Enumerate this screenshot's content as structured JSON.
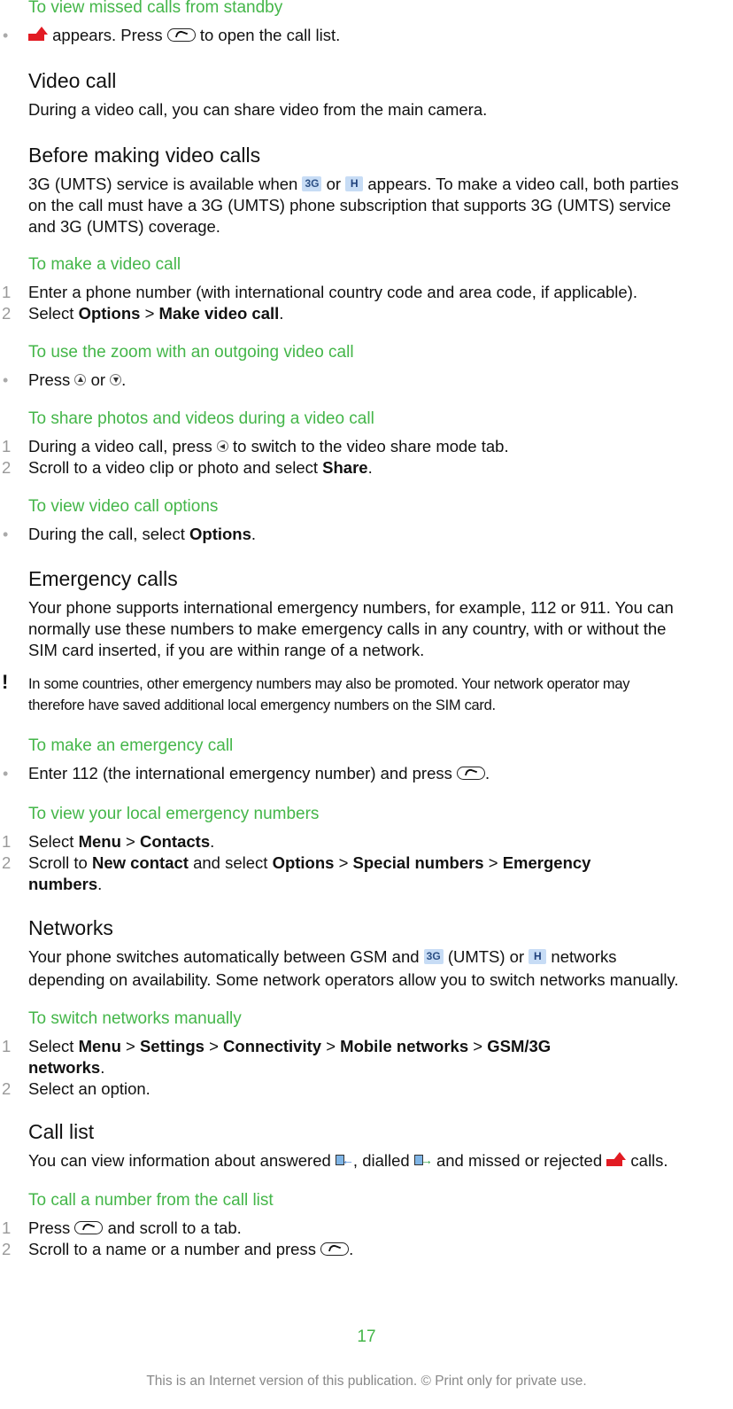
{
  "sections": {
    "missed_standby": {
      "heading": "To view missed calls from standby",
      "bullet": {
        "icon": "missed-call-icon",
        "t1": "appears. Press",
        "icon2": "call-key-icon",
        "t2": "to open the call list."
      }
    },
    "video_call": {
      "heading": "Video call",
      "body": "During a video call, you can share video from the main camera."
    },
    "before_video": {
      "heading": "Before making video calls",
      "t1": "3G (UMTS) service is available when",
      "icon_3g": "3G",
      "t_or": "or",
      "icon_h": "H",
      "line1_end": "appears. To make a video call, both parties",
      "line2": "on the call must have a 3G (UMTS) phone subscription that supports 3G (UMTS) service",
      "line3": "and 3G (UMTS) coverage."
    },
    "make_video": {
      "heading": "To make a video call",
      "steps": [
        {
          "num": "1",
          "text": "Enter a phone number (with international country code and area code, if applicable)."
        },
        {
          "num": "2",
          "pre": "Select ",
          "b1": "Options",
          "sep": " > ",
          "b2": "Make video call",
          "post": "."
        }
      ]
    },
    "zoom": {
      "heading": "To use the zoom with an outgoing video call",
      "bullet": {
        "t1": "Press",
        "t_or": "or",
        "post": "."
      }
    },
    "share": {
      "heading": "To share photos and videos during a video call",
      "steps": [
        {
          "num": "1",
          "t1": "During a video call, press",
          "t2": "to switch to the video share mode tab."
        },
        {
          "num": "2",
          "pre": "Scroll to a video clip or photo and select ",
          "b1": "Share",
          "post": "."
        }
      ]
    },
    "view_options": {
      "heading": "To view video call options",
      "bullet": {
        "pre": "During the call, select ",
        "b1": "Options",
        "post": "."
      }
    },
    "emergency": {
      "heading": "Emergency calls",
      "line1": "Your phone supports international emergency numbers, for example, 112 or 911. You can",
      "line2": "normally use these numbers to make emergency calls in any country, with or without the",
      "line3": "SIM card inserted, if you are within range of a network.",
      "note_mark": "!",
      "note1": "In some countries, other emergency numbers may also be promoted. Your network operator may",
      "note2": "therefore have saved additional local emergency numbers on the SIM card."
    },
    "make_emergency": {
      "heading": "To make an emergency call",
      "bullet": {
        "t1": "Enter 112 (the international emergency number) and press",
        "post": "."
      }
    },
    "local_emergency": {
      "heading": "To view your local emergency numbers",
      "steps": [
        {
          "num": "1",
          "pre": "Select ",
          "b1": "Menu",
          "sep": " > ",
          "b2": "Contacts",
          "post": "."
        },
        {
          "num": "2",
          "pre": "Scroll to ",
          "b1": "New contact",
          "mid": " and select ",
          "b2": "Options",
          "sep1": " > ",
          "b3": "Special numbers",
          "sep2": " > ",
          "b4": "Emergency",
          "b5": "numbers",
          "post": "."
        }
      ]
    },
    "networks": {
      "heading": "Networks",
      "t1": "Your phone switches automatically between GSM and",
      "t2": "(UMTS) or",
      "t3": "networks",
      "line2": "depending on availability. Some network operators allow you to switch networks manually."
    },
    "switch_networks": {
      "heading": "To switch networks manually",
      "steps": [
        {
          "num": "1",
          "pre": "Select ",
          "b1": "Menu",
          "s1": " > ",
          "b2": "Settings",
          "s2": " > ",
          "b3": "Connectivity",
          "s3": " > ",
          "b4": "Mobile networks",
          "s4": " > ",
          "b5": "GSM/3G",
          "b6": "networks",
          "post": "."
        },
        {
          "num": "2",
          "text": "Select an option."
        }
      ]
    },
    "call_list": {
      "heading": "Call list",
      "t1": "You can view information about answered",
      "t2": ", dialled",
      "t3": "and missed or rejected",
      "t4": "calls."
    },
    "call_from_list": {
      "heading": "To call a number from the call list",
      "steps": [
        {
          "num": "1",
          "t1": "Press",
          "t2": "and scroll to a tab."
        },
        {
          "num": "2",
          "t1": "Scroll to a name or a number and press",
          "post": "."
        }
      ]
    }
  },
  "bullet_symbol": "•",
  "page_number": "17",
  "footer": "This is an Internet version of this publication. © Print only for private use.",
  "colors": {
    "heading_green": "#44b649",
    "missed_red": "#e21b23",
    "icon_blue": "#c7dcf5"
  }
}
